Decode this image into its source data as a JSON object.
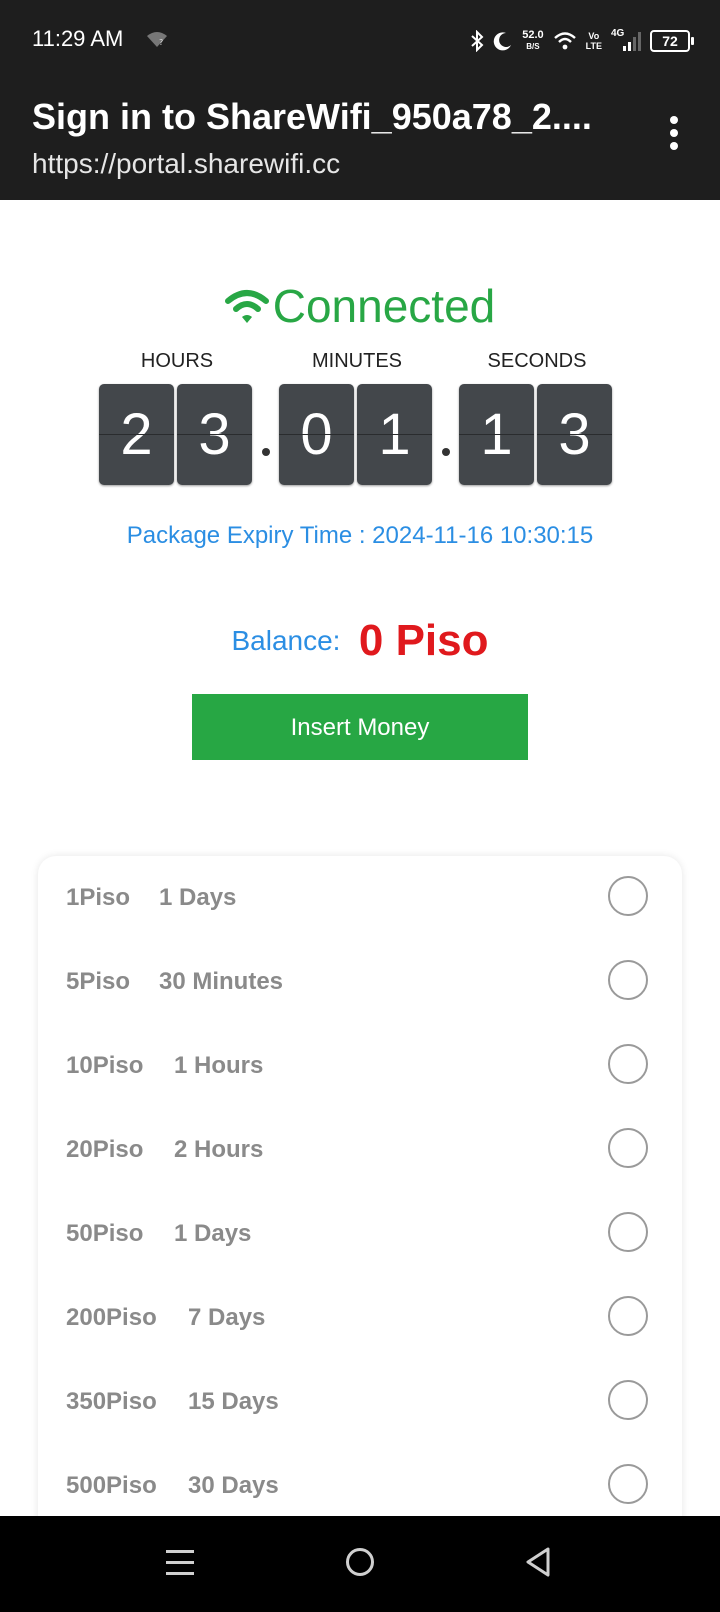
{
  "status_bar": {
    "time": "11:29 AM",
    "net_speed": "52.0",
    "net_speed_unit": "B/S",
    "volte_top": "Vo",
    "volte_bottom": "LTE",
    "network": "4G",
    "battery": "72",
    "icons": [
      "wifi-question-icon",
      "bluetooth-icon",
      "moon-icon",
      "wifi-icon",
      "signal-icon",
      "battery-icon"
    ]
  },
  "title_bar": {
    "title": "Sign in to ShareWifi_950a78_2....",
    "url": "https://portal.sharewifi.cc",
    "menu_icon": "more-vert-icon"
  },
  "connection": {
    "status": "Connected",
    "icon": "wifi-icon",
    "color": "#28a745"
  },
  "timer": {
    "labels": {
      "hours": "HOURS",
      "minutes": "MINUTES",
      "seconds": "SECONDS"
    },
    "hours": [
      "2",
      "3"
    ],
    "minutes": [
      "0",
      "1"
    ],
    "seconds": [
      "1",
      "3"
    ]
  },
  "expiry": "Package Expiry Time : 2024-11-16 10:30:15",
  "balance": {
    "label": "Balance:",
    "value": "0 Piso",
    "value_color": "#e0191d"
  },
  "insert_button": "Insert Money",
  "packages": [
    {
      "price": "1Piso",
      "duration": "1 Days"
    },
    {
      "price": "5Piso",
      "duration": "30 Minutes"
    },
    {
      "price": "10Piso",
      "duration": "1 Hours"
    },
    {
      "price": "20Piso",
      "duration": "2 Hours"
    },
    {
      "price": "50Piso",
      "duration": "1 Days"
    },
    {
      "price": "200Piso",
      "duration": "7 Days"
    },
    {
      "price": "350Piso",
      "duration": "15 Days"
    },
    {
      "price": "500Piso",
      "duration": "30 Days"
    }
  ],
  "nav_bar": [
    "recents-icon",
    "home-icon",
    "back-icon"
  ]
}
